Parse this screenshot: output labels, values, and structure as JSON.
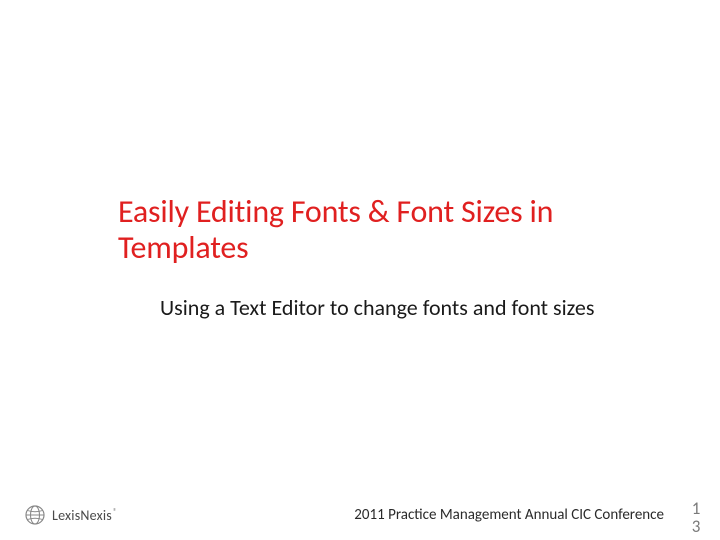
{
  "title": "Easily Editing Fonts & Font Sizes in Templates",
  "subtitle": "Using a Text Editor to change fonts and font sizes",
  "footer": "2011 Practice Management Annual CIC Conference",
  "page_number_top": "1",
  "page_number_bottom": "3",
  "logo": {
    "text": "LexisNexis",
    "registered": "®"
  }
}
